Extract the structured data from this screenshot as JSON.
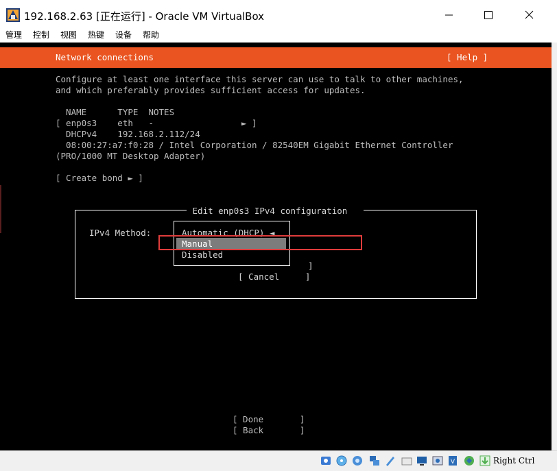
{
  "window": {
    "title": "192.168.2.63 [正在运行] - Oracle VM VirtualBox",
    "icon": "virtualbox-icon"
  },
  "menu": {
    "items": [
      "管理",
      "控制",
      "视图",
      "热键",
      "设备",
      "帮助"
    ]
  },
  "installer": {
    "header_title": "Network connections",
    "help_label": "[ Help ]",
    "intro_line1": "Configure at least one interface this server can use to talk to other machines,",
    "intro_line2": "and which preferably provides sufficient access for updates.",
    "table_header": "  NAME      TYPE  NOTES",
    "iface_row": "[ enp0s3    eth   -                 ► ]",
    "iface_addr": "  DHCPv4    192.168.2.112/24",
    "iface_mac": "  08:00:27:a7:f0:28 / Intel Corporation / 82540EM Gigabit Ethernet Controller",
    "iface_model": "(PRO/1000 MT Desktop Adapter)",
    "create_bond": "[ Create bond ► ]",
    "dialog": {
      "title": " Edit enp0s3 IPv4 configuration ",
      "method_label": "IPv4 Method:",
      "options": [
        "Automatic (DHCP) ◄",
        "Manual",
        "Disabled"
      ],
      "selected": "Manual",
      "save_bracket": "]",
      "cancel": "[ Cancel     ]"
    },
    "done": "[ Done       ]",
    "back": "[ Back       ]"
  },
  "statusbar": {
    "host_key": "Right Ctrl",
    "icons": [
      "hard-disk-icon",
      "optical-disk-icon",
      "audio-icon",
      "network-icon",
      "usb-icon",
      "shared-folder-icon",
      "display-icon",
      "recording-icon",
      "cpu-icon",
      "vt-x-icon",
      "mouse-integration-icon",
      "host-key-arrow-icon"
    ]
  },
  "colors": {
    "header_bar": "#e95420",
    "highlight": "#7c7c7c",
    "annotation_box": "#e03c3c"
  }
}
